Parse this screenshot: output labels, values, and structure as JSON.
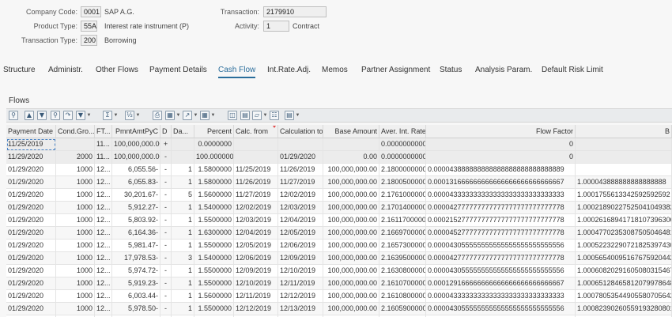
{
  "header": {
    "company_code_label": "Company Code:",
    "company_code": "0001",
    "company_name": "SAP A.G.",
    "product_type_label": "Product Type:",
    "product_type": "55A",
    "product_type_desc": "Interest rate instrument (P)",
    "transaction_type_label": "Transaction Type:",
    "transaction_type": "200",
    "transaction_type_desc": "Borrowing",
    "transaction_label": "Transaction:",
    "transaction": "2179910",
    "activity_label": "Activity:",
    "activity": "1",
    "activity_desc": "Contract"
  },
  "tabs": [
    {
      "label": "Structure"
    },
    {
      "label": "Administr."
    },
    {
      "label": "Other Flows"
    },
    {
      "label": "Payment Details"
    },
    {
      "label": "Cash Flow"
    },
    {
      "label": "Int.Rate.Adj."
    },
    {
      "label": "Memos"
    },
    {
      "label": "Partner Assignment"
    },
    {
      "label": "Status"
    },
    {
      "label": "Analysis Param."
    },
    {
      "label": "Default Risk Limit"
    }
  ],
  "active_tab": "Cash Flow",
  "flows_title": "Flows",
  "toolbar_icons": [
    "details-icon",
    "sort-ascending-icon",
    "sort-descending-icon",
    "find-icon",
    "find-next-icon",
    "filter-icon",
    "sum-icon",
    "subtotal-icon",
    "print-icon",
    "views-icon",
    "export-icon",
    "layout-icon",
    "columns-icon",
    "graphic-icon",
    "abc-analysis-icon",
    "info-icon"
  ],
  "table": {
    "columns": [
      "Payment Date",
      "Cond.Gro...",
      "FT...",
      "PmntAmtPyC",
      "D",
      "Da...",
      "Percent",
      "Calc. from",
      "Calculation to",
      "Base Amount",
      "Aver. Int. Rate",
      "Flow Factor",
      "B"
    ],
    "rows": [
      [
        "11/25/2019",
        "",
        "11...",
        "100,000,000.00",
        "+",
        "",
        "0.0000000",
        "",
        "",
        "",
        "0.0000000000",
        "0",
        ""
      ],
      [
        "11/29/2020",
        "2000",
        "11...",
        "100,000,000.00-",
        "-",
        "",
        "100.0000000",
        "",
        "01/29/2020",
        "0.00",
        "0.0000000000",
        "0",
        ""
      ],
      [
        "01/29/2020",
        "1000",
        "12...",
        "6,055.56-",
        "-",
        "1",
        "1.5800000",
        "11/25/2019",
        "11/26/2019",
        "100,000,000.00",
        "2.1800000000",
        "0.000043888888888888888888888888889",
        ""
      ],
      [
        "01/29/2020",
        "1000",
        "12...",
        "6,055.83-",
        "-",
        "1",
        "1.5800000",
        "11/26/2019",
        "11/27/2019",
        "100,000,000.00",
        "2.1800500000",
        "0.000131666666666666666666666666667",
        "1.000043888888888888888"
      ],
      [
        "01/29/2020",
        "1000",
        "12...",
        "30,201.67-",
        "-",
        "5",
        "1.5600000",
        "11/27/2019",
        "12/02/2019",
        "100,000,000.00",
        "2.1761000000",
        "0.000043333333333333333333333333333",
        "1.0001755613342592592592"
      ],
      [
        "01/29/2020",
        "1000",
        "12...",
        "5,912.27-",
        "-",
        "1",
        "1.5400000",
        "12/02/2019",
        "12/03/2019",
        "100,000,000.00",
        "2.1701400000",
        "0.000042777777777777777777777777778",
        "1.000218902275250410493827"
      ],
      [
        "01/29/2020",
        "1000",
        "12...",
        "5,803.92-",
        "-",
        "1",
        "1.5500000",
        "12/03/2019",
        "12/04/2019",
        "100,000,000.00",
        "2.1611700000",
        "0.000215277777777777777777777777778",
        "1.000261689417181073963069"
      ],
      [
        "01/29/2020",
        "1000",
        "12...",
        "6,164.36-",
        "-",
        "1",
        "1.6300000",
        "12/04/2019",
        "12/05/2019",
        "100,000,000.00",
        "2.1669700000",
        "0.000045277777777777777777777777778",
        "1.000477023530875050464814"
      ],
      [
        "01/29/2020",
        "1000",
        "12...",
        "5,981.47-",
        "-",
        "1",
        "1.5500000",
        "12/05/2019",
        "12/06/2019",
        "100,000,000.00",
        "2.1657300000",
        "0.000043055555555555555555555555556",
        "1.000522322907218253974305"
      ],
      [
        "01/29/2020",
        "1000",
        "12...",
        "17,978.53-",
        "-",
        "3",
        "1.5400000",
        "12/06/2019",
        "12/09/2019",
        "100,000,000.00",
        "2.1639500000",
        "0.000042777777777777777777777777778",
        "1.000565400951676759204426"
      ],
      [
        "01/29/2020",
        "1000",
        "12...",
        "5,974.72-",
        "-",
        "1",
        "1.5500000",
        "12/09/2019",
        "12/10/2019",
        "100,000,000.00",
        "2.1630800000",
        "0.000043055555555555555555555555556",
        "1.000608202916050803154678"
      ],
      [
        "01/29/2020",
        "1000",
        "12...",
        "5,919.23-",
        "-",
        "1",
        "1.5500000",
        "12/10/2019",
        "12/11/2019",
        "100,000,000.00",
        "2.1610700000",
        "0.000129166666666666666666666666667",
        "1.000651284658120799786480"
      ],
      [
        "01/29/2020",
        "1000",
        "12...",
        "6,003.44-",
        "-",
        "1",
        "1.5600000",
        "12/11/2019",
        "12/12/2019",
        "100,000,000.00",
        "2.1610800000",
        "0.000043333333333333333333333333333",
        "1.000780535449055807056427"
      ],
      [
        "01/29/2020",
        "1000",
        "12...",
        "5,978.50-",
        "-",
        "1",
        "1.5500000",
        "12/12/2019",
        "12/13/2019",
        "100,000,000.00",
        "2.1605900000",
        "0.000043055555555555555555555555556",
        "1.000823902605591932808019"
      ],
      [
        "01/29/2020",
        "1000",
        "12...",
        "17,951.25-",
        "-",
        "3",
        "1.5400000",
        "12/13/2019",
        "12/16/2019",
        "100,000,000.00",
        "2.1596700000",
        "0.000042777777777777777777777777778",
        "1.000866993634731895794087"
      ]
    ]
  }
}
